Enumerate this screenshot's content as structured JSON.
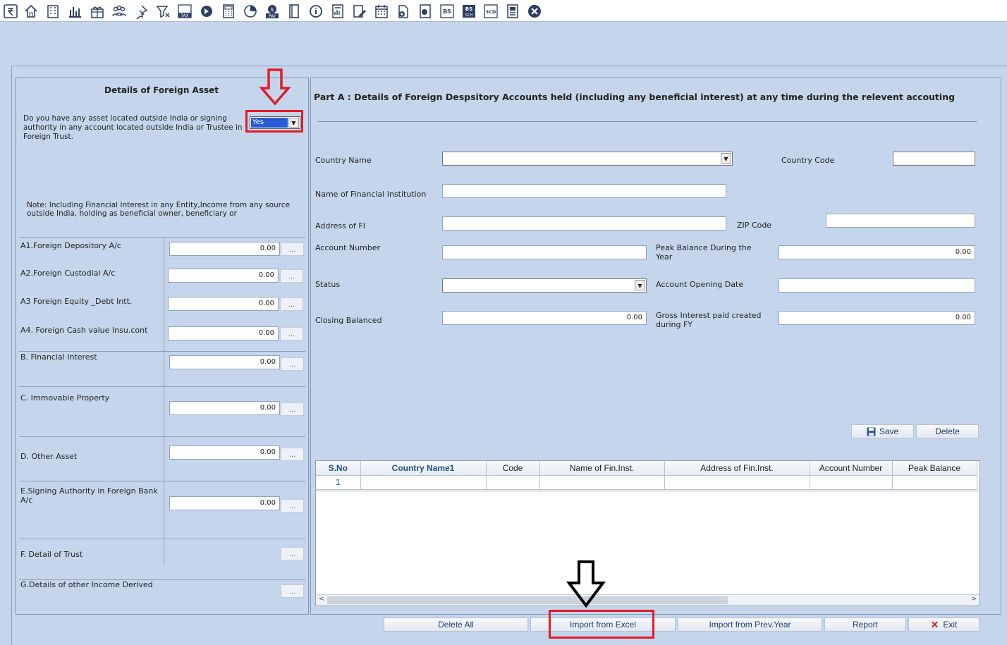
{
  "toolbar": {
    "icons": [
      "rupee-icon",
      "home-icon",
      "building-icon",
      "bar-chart-icon",
      "gift-icon",
      "group-icon",
      "pin-icon",
      "filter-icon",
      "tax-icon",
      "toggle-icon",
      "calculator-icon",
      "pie-icon",
      "pay-icon",
      "book-icon",
      "info-icon",
      "report-icon",
      "edit-doc-icon",
      "calendar-icon",
      "add-doc-icon",
      "doc-search-icon",
      "bs-icon",
      "bs-sch-icon",
      "3cd-icon",
      "form-icon",
      "close-icon"
    ],
    "tax_label": "TAX",
    "pay_label": "PAY",
    "bs_label": "BS",
    "bs_sch_top": "BS",
    "bs_sch_bottom": "SCH",
    "cd_label": "3CD"
  },
  "left": {
    "title": "Details of Foreign Asset",
    "question": "Do you have any asset located outside India or signing authority in any account located outside India or Trustee in Foreign Trust.",
    "yes_value": "Yes",
    "note": "Note: Including Financial Interest in any Entity,Income from any source outside India, holding as beneficial owner, beneficiary or",
    "rows": [
      {
        "label": "A1.Foreign Depository A/c",
        "value": "0.00"
      },
      {
        "label": "A2.Foreign Custodial A/c",
        "value": "0.00"
      },
      {
        "label": "A3 Foreign Equity _Debt Intt.",
        "value": "0.00"
      },
      {
        "label": "A4. Foreign Cash value Insu.cont",
        "value": "0.00"
      },
      {
        "label": "B. Financial Interest",
        "value": "0.00"
      },
      {
        "label": "C. Immovable Property",
        "value": "0.00"
      },
      {
        "label": "D. Other Asset",
        "value": "0.00"
      },
      {
        "label": "E.Signing Authority in Foreign Bank A/c",
        "value": "0.00"
      },
      {
        "label": "F. Detail of Trust"
      },
      {
        "label": "G.Details of other Income Derived"
      }
    ],
    "dots": "..."
  },
  "right": {
    "title": "Part A : Details of Foreign Despsitory Accounts held (including any beneficial interest) at any time during the relevent accouting",
    "country_name": "Country Name",
    "country_code": "Country Code",
    "fin_inst": "Name of Financial Institution",
    "address": "Address of FI",
    "zip": "ZIP Code",
    "account_number": "Account Number",
    "peak_balance": "Peak Balance During the Year",
    "peak_value": "0.00",
    "status": "Status",
    "opening_date": "Account Opening Date",
    "closing": "Closing Balanced",
    "closing_value": "0.00",
    "gross_interest": "Gross Interest paid created during FY",
    "gross_value": "0.00",
    "save": "Save",
    "delete": "Delete"
  },
  "grid": {
    "columns": [
      "S.No",
      "Country Name1",
      "Code",
      "Name of Fin.Inst.",
      "Address of Fin.Inst.",
      "Account Number",
      "Peak Balance"
    ],
    "rows": [
      [
        "1",
        "",
        "",
        "",
        "",
        "",
        ""
      ]
    ]
  },
  "footer": {
    "delete_all": "Delete All",
    "import_excel": "Import from Excel",
    "import_prev": "Import from Prev.Year",
    "report": "Report",
    "exit": "Exit"
  },
  "colors": {
    "highlight": "#e11d2a",
    "accent": "#1d3e6e"
  }
}
